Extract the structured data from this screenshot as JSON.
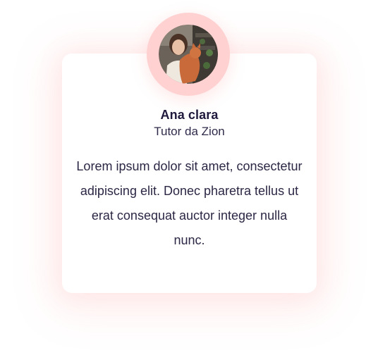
{
  "testimonial": {
    "name": "Ana clara",
    "role": "Tutor da Zion",
    "quote": "Lorem ipsum dolor sit amet, consectetur adipiscing elit. Donec pharetra tellus ut erat consequat auctor integer nulla nunc."
  },
  "colors": {
    "ring": "#ffd1d1",
    "name": "#1f1a3d",
    "text": "#2b2745",
    "card": "#ffffff"
  }
}
